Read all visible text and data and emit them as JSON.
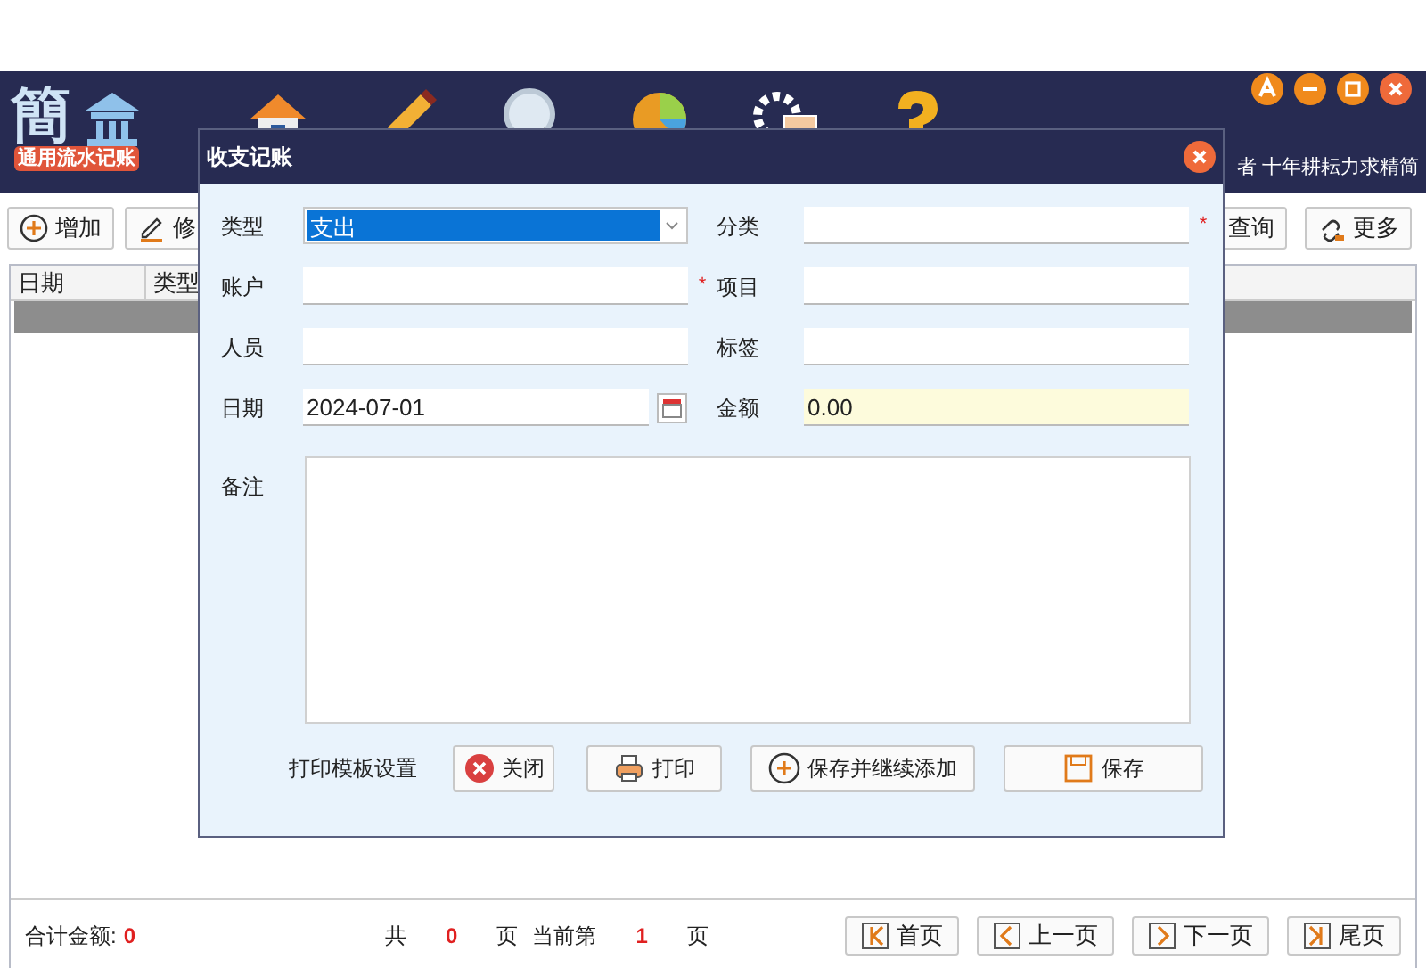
{
  "app": {
    "logo": "簡",
    "subtitle": "通用流水记账",
    "tagline": "者 十年耕耘力求精简"
  },
  "toolbar_left": [
    {
      "label": "增加",
      "kind": "add"
    },
    {
      "label": "修",
      "kind": "edit"
    }
  ],
  "toolbar_right": [
    {
      "label": "查询"
    },
    {
      "label": "更多",
      "kind": "link"
    }
  ],
  "table": {
    "columns": [
      "日期",
      "类型"
    ]
  },
  "footer": {
    "total_label": "合计金额:",
    "total": "0",
    "pages_prefix": "共",
    "pages": "0",
    "pages_unit": "页",
    "current_prefix": "当前第",
    "current": "1",
    "current_unit": "页",
    "buttons": [
      {
        "label": "首页",
        "kind": "first"
      },
      {
        "label": "上一页",
        "kind": "prev"
      },
      {
        "label": "下一页",
        "kind": "next"
      },
      {
        "label": "尾页",
        "kind": "last"
      }
    ]
  },
  "dialog": {
    "title": "收支记账",
    "left_fields": [
      {
        "label": "类型",
        "kind": "select",
        "value": "支出"
      },
      {
        "label": "账户",
        "kind": "text",
        "required_mark": "*"
      },
      {
        "label": "人员",
        "kind": "text"
      },
      {
        "label": "日期",
        "kind": "date",
        "value": "2024-07-01"
      }
    ],
    "right_fields": [
      {
        "label": "分类",
        "kind": "text",
        "required_mark": "*"
      },
      {
        "label": "项目",
        "kind": "text"
      },
      {
        "label": "标签",
        "kind": "text"
      },
      {
        "label": "金额",
        "kind": "amount",
        "value": "0.00"
      }
    ],
    "notes_label": "备注",
    "print_link": "打印模板设置",
    "buttons": [
      {
        "label": "关闭",
        "kind": "close"
      },
      {
        "label": "打印",
        "kind": "print"
      },
      {
        "label": "保存并继续添加",
        "kind": "add"
      },
      {
        "label": "保存",
        "kind": "save"
      }
    ]
  }
}
